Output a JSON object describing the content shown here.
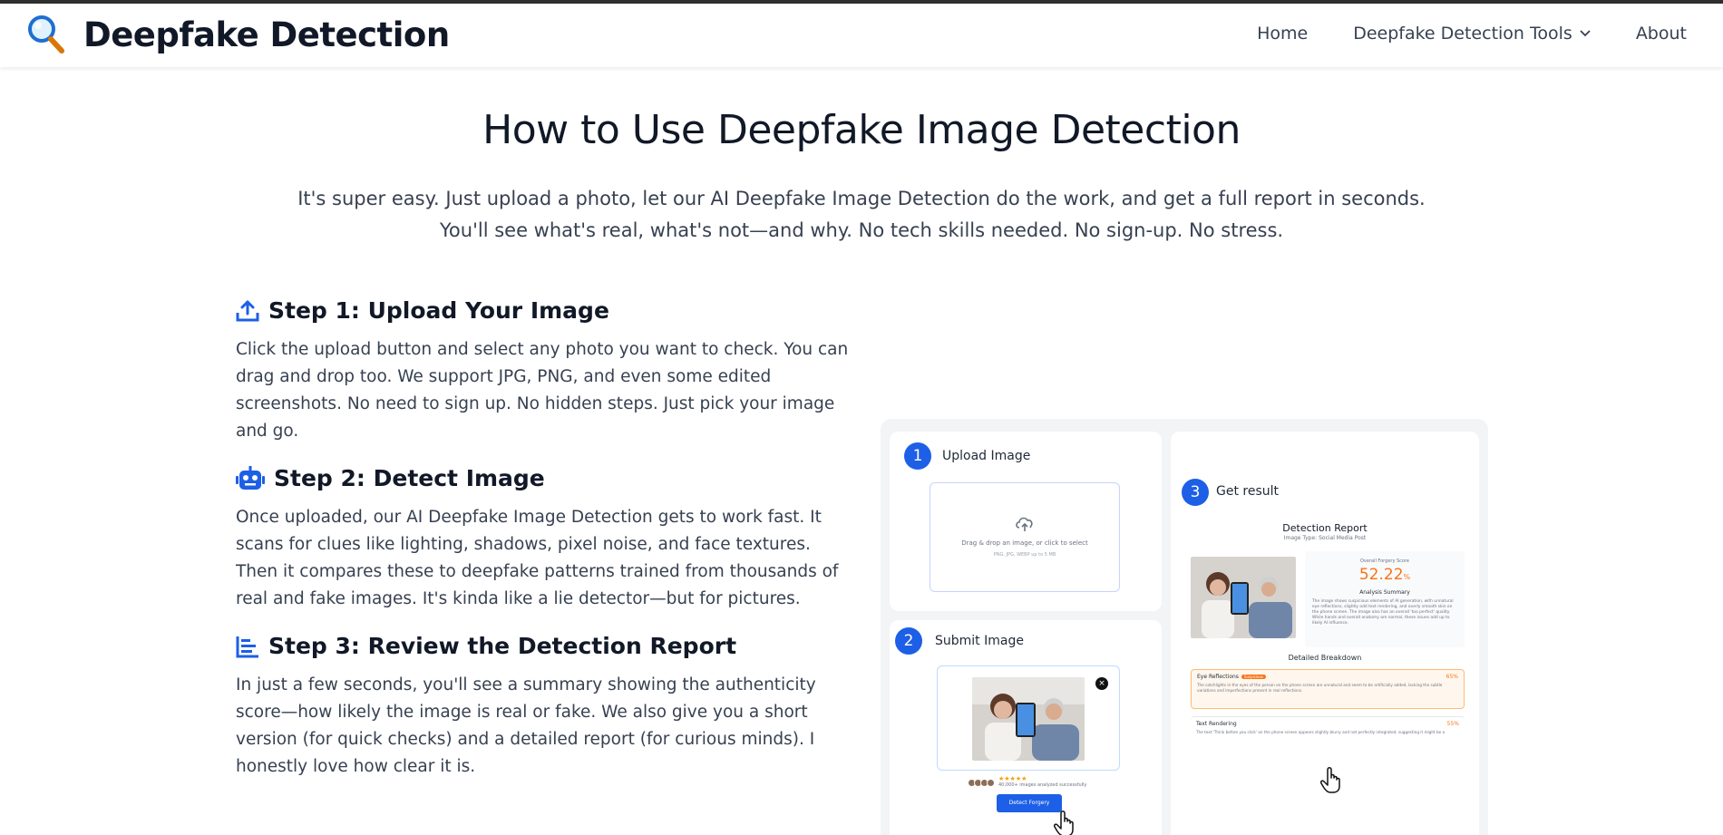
{
  "site": {
    "brand_title": "Deepfake Detection",
    "brand_icon": "magnifier-icon"
  },
  "nav": {
    "home": "Home",
    "tools": "Deepfake Detection Tools",
    "about": "About"
  },
  "hero": {
    "title": "How to Use Deepfake Image Detection",
    "subtitle": "It's super easy. Just upload a photo, let our AI Deepfake Image Detection do the work, and get a full report in seconds. You'll see what's real, what's not—and why. No tech skills needed. No sign-up. No stress."
  },
  "steps": [
    {
      "icon": "upload-icon",
      "title": "Step 1: Upload Your Image",
      "body": "Click the upload button and select any photo you want to check. You can drag and drop too. We support JPG, PNG, and even some edited screenshots. No need to sign up. No hidden steps. Just pick your image and go."
    },
    {
      "icon": "robot-icon",
      "title": "Step 2: Detect Image",
      "body": "Once uploaded, our AI Deepfake Image Detection gets to work fast. It scans for clues like lighting, shadows, pixel noise, and face textures. Then it compares these to deepfake patterns trained from thousands of real and fake images. It's kinda like a lie detector—but for pictures."
    },
    {
      "icon": "bar-chart-icon",
      "title": "Step 3: Review the Detection Report",
      "body": "In just a few seconds, you'll see a summary showing the authenticity score—how likely the image is real or fake. We also give you a short version (for quick checks) and a detailed report (for curious minds). I honestly love how clear it is."
    }
  ],
  "illustration": {
    "card1": {
      "num": "1",
      "label": "Upload Image",
      "drop_text": "Drag & drop an image, or click to select",
      "drop_hint": "PNG, JPG, WEBP up to 5 MB"
    },
    "card2": {
      "num": "2",
      "label": "Submit Image",
      "rating_stars": "★★★★★",
      "rating_text": "40,000+ images analyzed successfully",
      "button": "Detect Forgery",
      "close": "×"
    },
    "card3": {
      "num": "3",
      "label": "Get result",
      "report_title": "Detection Report",
      "report_sub": "Image Type: Social Media Post",
      "score_caption": "Overall Forgery Score",
      "score_value": "52.22",
      "score_unit": "%",
      "summary_title": "Analysis Summary",
      "summary_text": "The image shows suspicious elements of AI generation, with unnatural eye reflections, slightly odd text rendering, and overly smooth skin on the phone screen. The image also has an overall 'too perfect' quality. While hands and overall anatomy are normal, these issues add up to likely AI influence.",
      "breakdown_title": "Detailed Breakdown",
      "items": [
        {
          "name": "Eye Reflections",
          "tag": "Suspicious",
          "pct": "65%",
          "text": "The catchlights in the eyes of the person on the phone screen are unnatural and seem to be artificially added, lacking the subtle variations and imperfections present in real reflections."
        },
        {
          "name": "Text Rendering",
          "tag": "",
          "pct": "55%",
          "text": "The text 'Think before you click' on the phone screen appears slightly blurry and not perfectly integrated, suggesting it might be a"
        }
      ]
    }
  },
  "colors": {
    "accent": "#1d5fe6",
    "score": "#f97316",
    "title": "#111827"
  }
}
